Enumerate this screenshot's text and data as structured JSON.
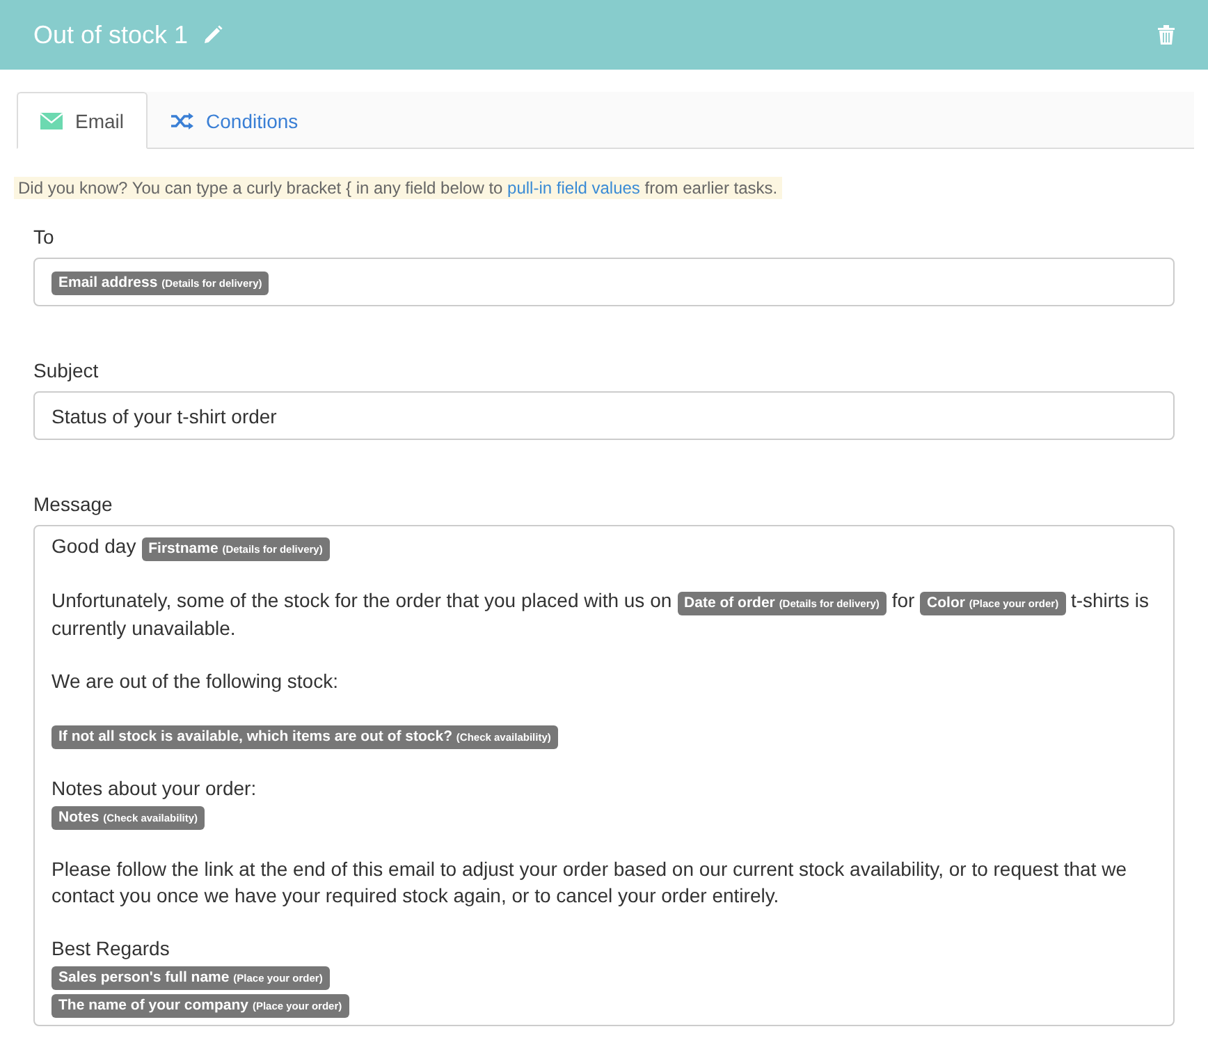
{
  "header": {
    "title": "Out of stock 1"
  },
  "tabs": [
    {
      "label": "Email",
      "selected": true
    },
    {
      "label": "Conditions",
      "selected": false
    }
  ],
  "tip": {
    "before": "Did you know? You can type a curly bracket { in any field below to ",
    "link": "pull-in field values",
    "after": " from earlier tasks."
  },
  "to": {
    "label": "To",
    "tags": [
      {
        "name": "Email address",
        "source": "(Details for delivery)"
      }
    ]
  },
  "subject": {
    "label": "Subject",
    "value": "Status of your t-shirt order"
  },
  "message": {
    "label": "Message",
    "paragraphs": [
      [
        [
          {
            "kind": "text",
            "text": "Good day"
          },
          {
            "kind": "tag",
            "name": "Firstname",
            "source": "(Details for delivery)"
          }
        ]
      ],
      [
        [
          {
            "kind": "text",
            "text": "Unfortunately, some of the stock for the order that you placed with us on"
          },
          {
            "kind": "tag",
            "name": "Date of order",
            "source": "(Details for delivery)"
          },
          {
            "kind": "text",
            "text": "for"
          },
          {
            "kind": "tag",
            "name": "Color",
            "source": "(Place your order)"
          },
          {
            "kind": "text",
            "text": "t-shirts is currently unavailable."
          }
        ]
      ],
      [
        [
          {
            "kind": "text",
            "text": "We are out of the following stock:"
          }
        ]
      ],
      [
        [
          {
            "kind": "tag",
            "name": "If not all stock is available, which items are out of stock?",
            "source": "(Check availability)"
          }
        ]
      ],
      [
        [
          {
            "kind": "text",
            "text": "Notes about your order:"
          }
        ],
        [
          {
            "kind": "tag",
            "name": "Notes",
            "source": "(Check availability)"
          }
        ]
      ],
      [
        [
          {
            "kind": "text",
            "text": "Please follow the link at the end of this email to adjust your order based on our current stock availability, or to request that we contact you once we have your required stock again, or to cancel your order entirely."
          }
        ]
      ],
      [
        [
          {
            "kind": "text",
            "text": "Best Regards"
          }
        ],
        [
          {
            "kind": "tag",
            "name": "Sales person's full name",
            "source": "(Place your order)"
          }
        ],
        [
          {
            "kind": "tag",
            "name": "The name of your company",
            "source": "(Place your order)"
          }
        ]
      ]
    ]
  }
}
